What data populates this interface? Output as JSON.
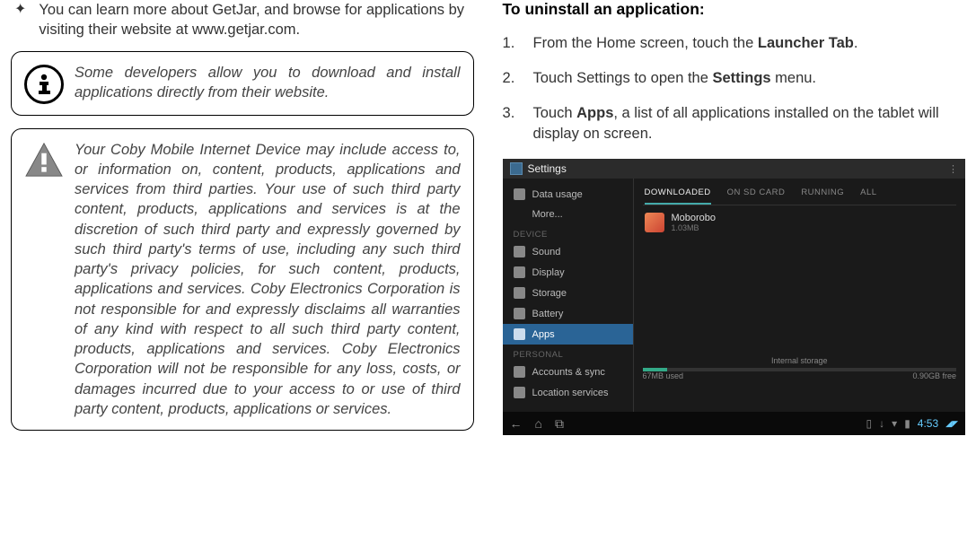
{
  "left": {
    "bullet": "You can learn more about GetJar, and browse for applications by visiting their website at www.getjar.com.",
    "info1": "Some developers allow you to download and install applications directly from their website.",
    "info2": "Your Coby Mobile Internet Device may include access to, or information on, content, products, applications and services from third parties. Your use of such third party content, products, applications and services is at the discretion of such third party and expressly governed by such third party's terms of use, including any such third party's privacy policies, for such content, products, applications and services. Coby Electronics Corporation is not responsible for and expressly disclaims all warranties of any kind with respect to all such third party content, products, applications and services. Coby Electronics Corporation will not be responsible for any loss, costs, or damages incurred due to your access to or use of third party content, products, applications or services."
  },
  "right": {
    "heading": "To uninstall an application:",
    "step1_a": "From the Home screen, touch the ",
    "step1_b": "Launcher Tab",
    "step1_c": ".",
    "step2_a": "Touch Settings to open the ",
    "step2_b": "Settings",
    "step2_c": " menu.",
    "step3_a": "Touch ",
    "step3_b": "Apps",
    "step3_c": ", a list of all applications installed on the tablet will display on screen."
  },
  "screenshot": {
    "title": "Settings",
    "sidebar": {
      "data_usage": "Data usage",
      "more": "More...",
      "section_device": "DEVICE",
      "sound": "Sound",
      "display": "Display",
      "storage": "Storage",
      "battery": "Battery",
      "apps": "Apps",
      "section_personal": "PERSONAL",
      "accounts": "Accounts & sync",
      "location": "Location services"
    },
    "tabs": {
      "downloaded": "DOWNLOADED",
      "onsd": "ON SD CARD",
      "running": "RUNNING",
      "all": "ALL"
    },
    "app": {
      "name": "Moborobo",
      "size": "1.03MB"
    },
    "storage": {
      "label": "Internal storage",
      "used": "67MB used",
      "free": "0.90GB free"
    },
    "clock": "4:53"
  }
}
